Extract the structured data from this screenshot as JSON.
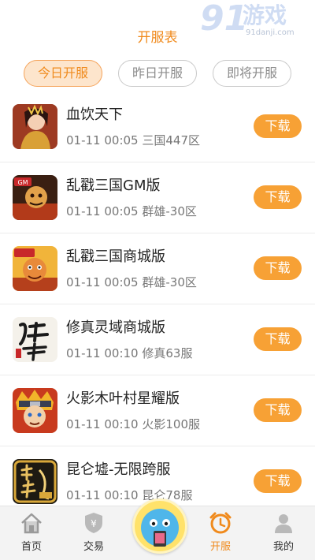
{
  "header": {
    "title": "开服表"
  },
  "watermark": {
    "big": "91",
    "text": "游戏",
    "url": "91danji.com"
  },
  "tabs": [
    {
      "label": "今日开服",
      "active": true
    },
    {
      "label": "昨日开服",
      "active": false
    },
    {
      "label": "即将开服",
      "active": false
    }
  ],
  "games": [
    {
      "name": "血饮天下",
      "time": "01-11 00:05",
      "server": "三国447区",
      "button": "下载",
      "icon": "game-xueyin-icon"
    },
    {
      "name": "乱戳三国GM版",
      "time": "01-11 00:05",
      "server": "群雄-30区",
      "button": "下载",
      "icon": "game-luanchuo-gm-icon"
    },
    {
      "name": "乱戳三国商城版",
      "time": "01-11 00:05",
      "server": "群雄-30区",
      "button": "下载",
      "icon": "game-luanchuo-shop-icon"
    },
    {
      "name": "修真灵域商城版",
      "time": "01-11 00:10",
      "server": "修真63服",
      "button": "下载",
      "icon": "game-xiuzhen-icon"
    },
    {
      "name": "火影木叶村星耀版",
      "time": "01-11 00:10",
      "server": "火影100服",
      "button": "下载",
      "icon": "game-huoying-icon"
    },
    {
      "name": "昆仑墟-无限跨服",
      "time": "01-11 00:10",
      "server": "昆仑78服",
      "button": "下载",
      "icon": "game-kunlun-icon"
    }
  ],
  "tabbar": [
    {
      "label": "首页",
      "icon": "home-icon"
    },
    {
      "label": "交易",
      "icon": "trade-shield-icon"
    },
    {
      "label": "开服",
      "icon": "alarm-clock-icon",
      "active": true
    },
    {
      "label": "我的",
      "icon": "user-icon"
    }
  ],
  "colors": {
    "accent": "#f08a1c",
    "button": "#f7a135",
    "tab_active_bg": "#fde5cc"
  }
}
